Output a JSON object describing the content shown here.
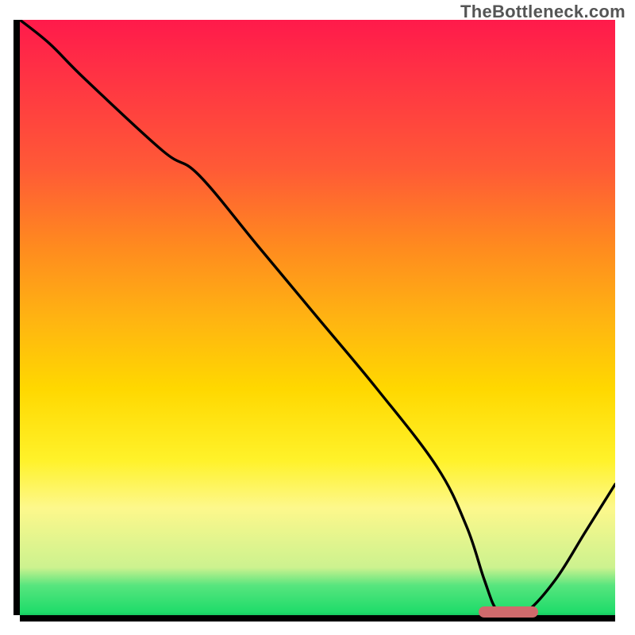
{
  "watermark": "TheBottleneck.com",
  "colors": {
    "gradient_top": "#ff1a4b",
    "gradient_bottom": "#16c95f",
    "axis": "#000000",
    "curve": "#000000",
    "marker": "#d06a6c",
    "watermark": "#555555"
  },
  "chart_data": {
    "type": "line",
    "title": "",
    "xlabel": "",
    "ylabel": "",
    "xlim": [
      0,
      100
    ],
    "ylim": [
      0,
      100
    ],
    "grid": false,
    "legend": false,
    "series": [
      {
        "name": "bottleneck-curve",
        "x": [
          0,
          5,
          11,
          24,
          30,
          40,
          50,
          60,
          70,
          75,
          78,
          80,
          82,
          85,
          90,
          95,
          100
        ],
        "values": [
          100,
          96,
          90,
          78,
          74,
          62,
          50,
          38,
          25,
          15,
          6,
          1,
          0.5,
          0.5,
          6,
          14,
          22
        ]
      }
    ],
    "annotations": [
      {
        "name": "optimal-zone-marker",
        "x_start": 77,
        "x_end": 87,
        "y": 0.6,
        "color": "#d06a6c"
      }
    ]
  }
}
